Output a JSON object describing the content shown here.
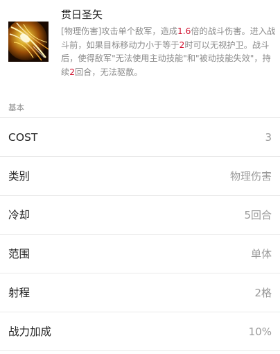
{
  "skill": {
    "name": "贯日圣矢",
    "description_parts": [
      {
        "text": "[物理伤害]攻击单个敌军，造成",
        "highlight": false
      },
      {
        "text": "1.6",
        "highlight": true
      },
      {
        "text": "倍的战斗伤害。进入战斗前，如果目标移动力小于等于",
        "highlight": false
      },
      {
        "text": "2",
        "highlight": true
      },
      {
        "text": "时可以无视护卫。战斗后，使得敌军\"无法使用主动技能\"和\"被动技能失效\"，持续",
        "highlight": false
      },
      {
        "text": "2",
        "highlight": true
      },
      {
        "text": "回合，无法驱散。",
        "highlight": false
      }
    ],
    "icon": "golden-arrow-skill-icon"
  },
  "section": {
    "label": "基本"
  },
  "attributes": [
    {
      "label": "COST",
      "value": "3"
    },
    {
      "label": "类别",
      "value": "物理伤害"
    },
    {
      "label": "冷却",
      "value": "5回合"
    },
    {
      "label": "范围",
      "value": "单体"
    },
    {
      "label": "射程",
      "value": "2格"
    },
    {
      "label": "战力加成",
      "value": "10%"
    }
  ],
  "colors": {
    "highlight": "#d0102e",
    "muted_text": "#8a8a8a",
    "value_text": "#999999",
    "divider": "#e9e9e9"
  }
}
